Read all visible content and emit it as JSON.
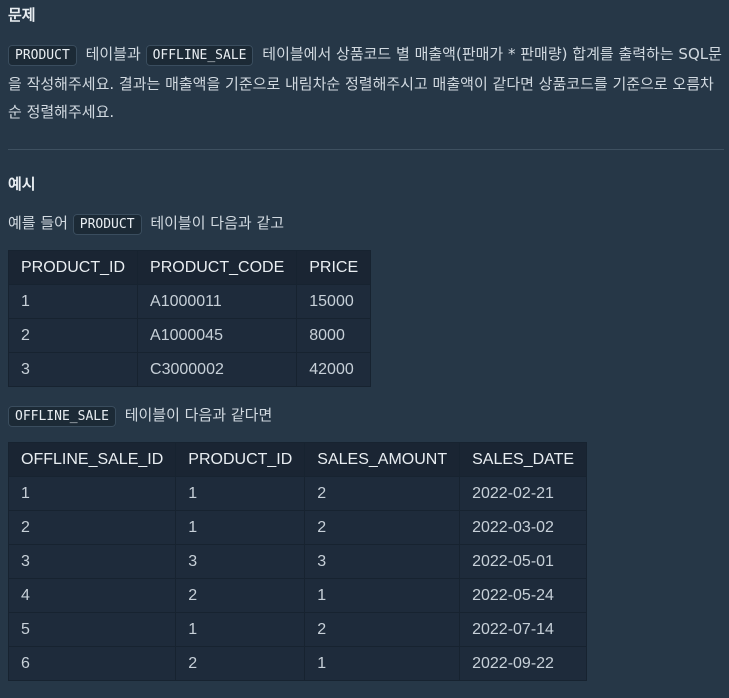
{
  "problem": {
    "heading": "문제",
    "code1": "PRODUCT",
    "text1": "테이블과",
    "code2": "OFFLINE_SALE",
    "text2": "테이블에서 상품코드 별 매출액(판매가 * 판매량) 합계를 출력하는 SQL문을 작성해주세요. 결과는 매출액을 기준으로 내림차순 정렬해주시고 매출액이 같다면 상품코드를 기준으로 오름차순 정렬해주세요."
  },
  "example": {
    "heading": "예시",
    "intro_prefix": "예를 들어",
    "intro_code": "PRODUCT",
    "intro_suffix": "테이블이 다음과 같고",
    "second_code": "OFFLINE_SALE",
    "second_suffix": "테이블이 다음과 같다면"
  },
  "product_table": {
    "headers": [
      "PRODUCT_ID",
      "PRODUCT_CODE",
      "PRICE"
    ],
    "rows": [
      [
        "1",
        "A1000011",
        "15000"
      ],
      [
        "2",
        "A1000045",
        "8000"
      ],
      [
        "3",
        "C3000002",
        "42000"
      ]
    ]
  },
  "offline_sale_table": {
    "headers": [
      "OFFLINE_SALE_ID",
      "PRODUCT_ID",
      "SALES_AMOUNT",
      "SALES_DATE"
    ],
    "rows": [
      [
        "1",
        "1",
        "2",
        "2022-02-21"
      ],
      [
        "2",
        "1",
        "2",
        "2022-03-02"
      ],
      [
        "3",
        "3",
        "3",
        "2022-05-01"
      ],
      [
        "4",
        "2",
        "1",
        "2022-05-24"
      ],
      [
        "5",
        "1",
        "2",
        "2022-07-14"
      ],
      [
        "6",
        "2",
        "1",
        "2022-09-22"
      ]
    ]
  }
}
